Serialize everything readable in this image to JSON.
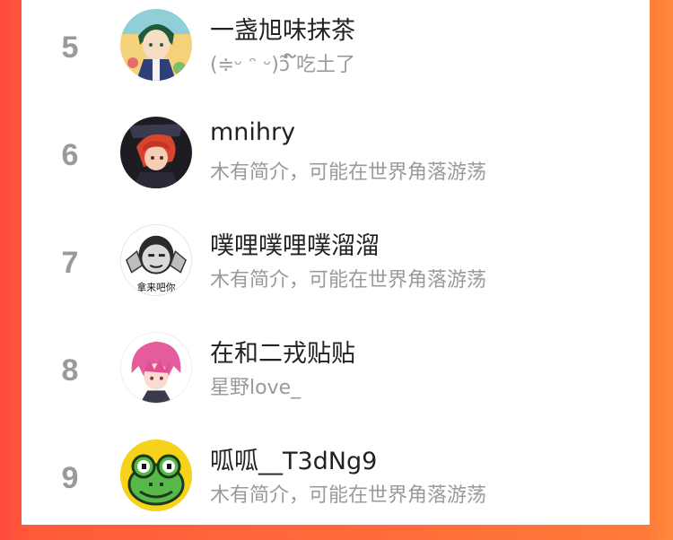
{
  "leaderboard": [
    {
      "rank": "5",
      "name": "一盏旭味抹茶",
      "bio": "(≑ᵕ ᵔ ᵕ)ɔ̃ ໌໌໌吃土了",
      "avatar": "anime-boy-avatar"
    },
    {
      "rank": "6",
      "name": "mnihry",
      "bio": "木有简介，可能在世界角落游荡",
      "avatar": "red-hair-anime-avatar"
    },
    {
      "rank": "7",
      "name": "噗哩噗哩噗溜溜",
      "bio": "木有简介，可能在世界角落游荡",
      "avatar": "meme-face-avatar",
      "avatar_caption": "拿来吧你"
    },
    {
      "rank": "8",
      "name": "在和二戎贴贴",
      "bio": "星野love_",
      "avatar": "pink-hair-anime-avatar"
    },
    {
      "rank": "9",
      "name": "呱呱__T3dNg9",
      "bio": "木有简介，可能在世界角落游荡",
      "avatar": "frog-avatar"
    }
  ],
  "colors": {
    "accent_left": "#ff4a3d",
    "accent_right": "#ff8a3a",
    "rank": "#9a9a9a",
    "name": "#222222",
    "bio": "#9a9a9a"
  }
}
